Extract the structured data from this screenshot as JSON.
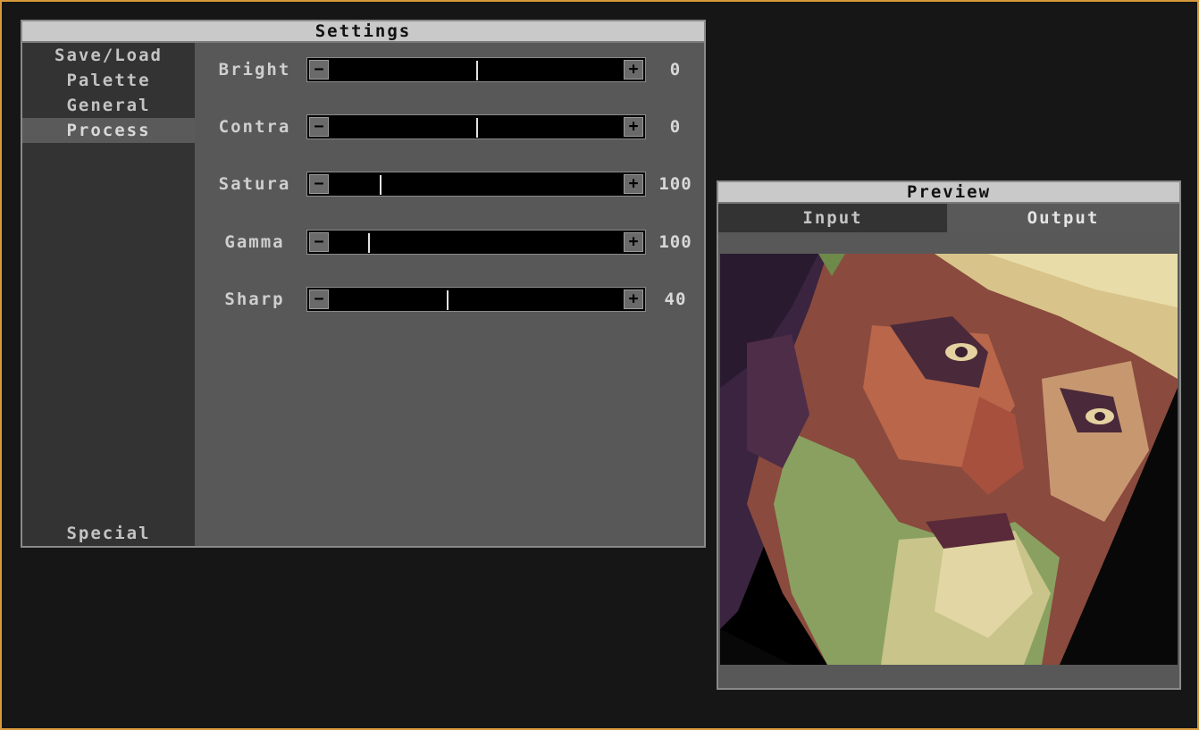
{
  "settings_window": {
    "title": "Settings",
    "sidebar": {
      "items": [
        {
          "label": "Save/Load"
        },
        {
          "label": "Palette"
        },
        {
          "label": "General"
        },
        {
          "label": "Process"
        }
      ],
      "bottom_item": {
        "label": "Special"
      },
      "active": "Process"
    },
    "params": [
      {
        "label": "Bright",
        "value": "0",
        "level": 0.5
      },
      {
        "label": "Contra",
        "value": "0",
        "level": 0.5
      },
      {
        "label": "Satura",
        "value": "100",
        "level": 0.17
      },
      {
        "label": "Gamma",
        "value": "100",
        "level": 0.13
      },
      {
        "label": "Sharp",
        "value": "40",
        "level": 0.4
      }
    ],
    "minus_glyph": "−",
    "plus_glyph": "+"
  },
  "preview_window": {
    "title": "Preview",
    "tabs": [
      {
        "label": "Input"
      },
      {
        "label": "Output"
      }
    ],
    "active_tab": "Output"
  },
  "colors": {
    "frame_accent": "#d79a3a",
    "background": "#161616",
    "panel": "#585858",
    "sidebar": "#333333",
    "titlebar": "#c9c9c9"
  }
}
